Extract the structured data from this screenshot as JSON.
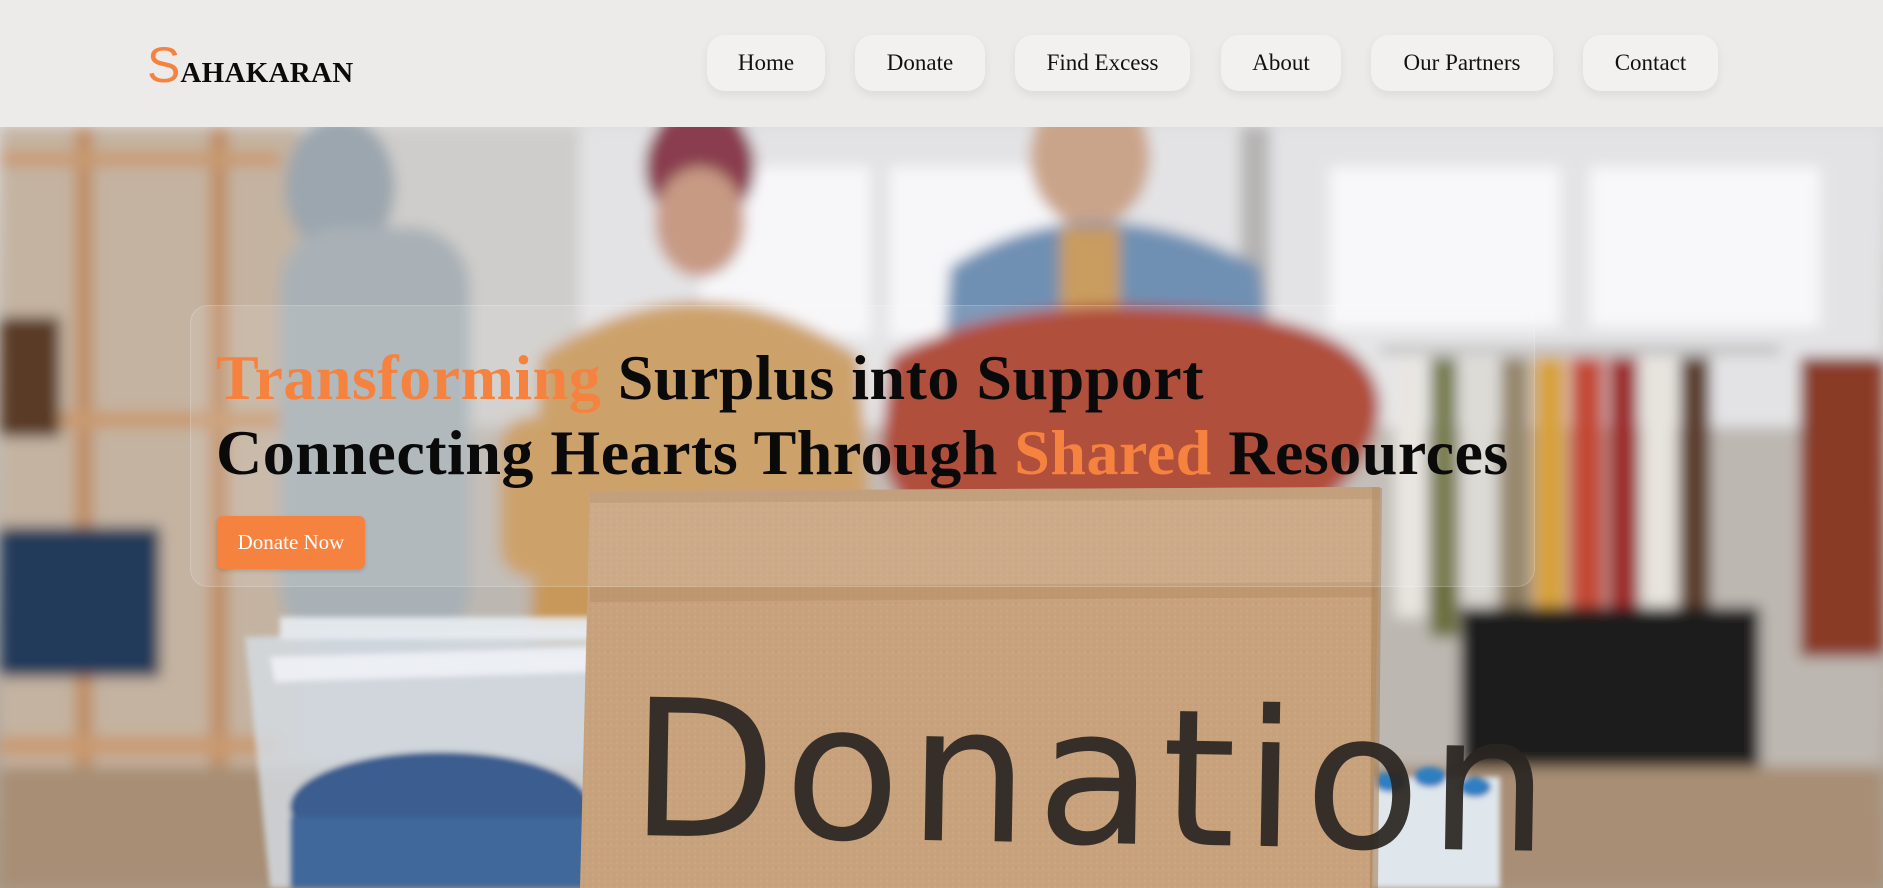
{
  "brand": {
    "initial": "S",
    "rest": "AHAKARAN"
  },
  "nav": {
    "items": [
      {
        "label": "Home"
      },
      {
        "label": "Donate"
      },
      {
        "label": "Find Excess"
      },
      {
        "label": "About"
      },
      {
        "label": "Our Partners"
      },
      {
        "label": "Contact"
      }
    ]
  },
  "hero": {
    "line1_accent": "Transforming",
    "line1_rest": " Surplus into Support",
    "line2_start": "Connecting Hearts Through ",
    "line2_accent": "Shared",
    "line2_end": " Resources",
    "cta_label": "Donate Now",
    "sign_text": "Donation"
  },
  "colors": {
    "accent": "#f5833f",
    "header_bg": "#ecebea",
    "nav_pill_bg": "#f2f1f0",
    "headline_text": "#0a0a0a"
  }
}
